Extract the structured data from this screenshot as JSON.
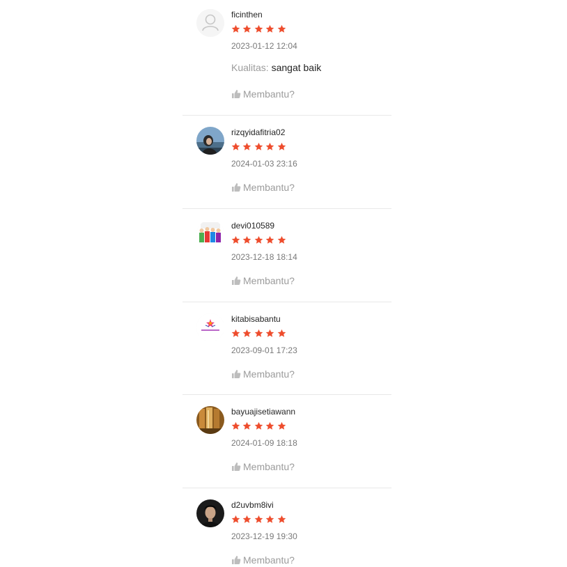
{
  "colors": {
    "star": "#ee4d2d",
    "divider": "#e8e8e8",
    "muted": "#9e9e9e"
  },
  "reviews": [
    {
      "username": "ficinthen",
      "rating": 5,
      "timestamp": "2023-01-12 12:04",
      "attribute_label": "Kualitas:",
      "attribute_value": "sangat baik",
      "helpful_label": "Membantu?",
      "avatar": "default-avatar-icon"
    },
    {
      "username": "rizqyidafitria02",
      "rating": 5,
      "timestamp": "2024-01-03 23:16",
      "helpful_label": "Membantu?",
      "avatar": "user-photo"
    },
    {
      "username": "devi010589",
      "rating": 5,
      "timestamp": "2023-12-18 18:14",
      "helpful_label": "Membantu?",
      "avatar": "group-cartoon-photo"
    },
    {
      "username": "kitabisabantu",
      "rating": 5,
      "timestamp": "2023-09-01 17:23",
      "helpful_label": "Membantu?",
      "avatar": "logo-photo"
    },
    {
      "username": "bayuajisetiawann",
      "rating": 5,
      "timestamp": "2024-01-09 18:18",
      "helpful_label": "Membantu?",
      "avatar": "wooden-door-photo"
    },
    {
      "username": "d2uvbm8ivi",
      "rating": 5,
      "timestamp": "2023-12-19 19:30",
      "helpful_label": "Membantu?",
      "avatar": "portrait-photo"
    }
  ]
}
